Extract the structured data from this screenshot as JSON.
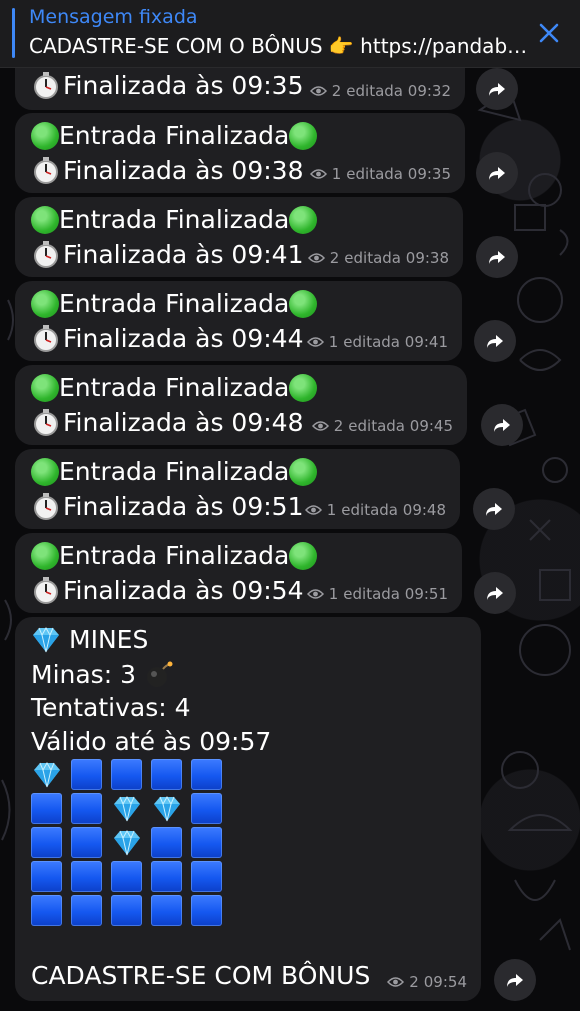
{
  "pinned": {
    "title": "Mensagem fixada",
    "text": "CADASTRE-SE COM O BÔNUS 👉 https://pandabet...",
    "close_icon": "close-icon",
    "accent_color": "#3e88f7"
  },
  "messages": [
    {
      "line1": "",
      "line2": "Finalizada às 09:35",
      "views": "2",
      "edited": "editada 09:32",
      "partial": true
    },
    {
      "line1": "Entrada Finalizada",
      "line2": "Finalizada às 09:38",
      "views": "1",
      "edited": "editada 09:35"
    },
    {
      "line1": "Entrada Finalizada",
      "line2": "Finalizada às 09:41",
      "views": "2",
      "edited": "editada 09:38"
    },
    {
      "line1": "Entrada Finalizada",
      "line2": "Finalizada às 09:44",
      "views": "1",
      "edited": "editada 09:41"
    },
    {
      "line1": "Entrada Finalizada",
      "line2": "Finalizada às 09:48",
      "views": "2",
      "edited": "editada 09:45"
    },
    {
      "line1": "Entrada Finalizada",
      "line2": "Finalizada às 09:51",
      "views": "1",
      "edited": "editada 09:48"
    },
    {
      "line1": "Entrada Finalizada",
      "line2": "Finalizada às 09:54",
      "views": "1",
      "edited": "editada 09:51"
    }
  ],
  "mines_message": {
    "title": "MINES",
    "minas": "Minas: 3",
    "tentativas": "Tentativas: 4",
    "valido": "Válido até às 09:57",
    "grid": [
      [
        "diamond",
        "square",
        "square",
        "square",
        "square"
      ],
      [
        "square",
        "square",
        "diamond",
        "diamond",
        "square"
      ],
      [
        "square",
        "square",
        "diamond",
        "square",
        "square"
      ],
      [
        "square",
        "square",
        "square",
        "square",
        "square"
      ],
      [
        "square",
        "square",
        "square",
        "square",
        "square"
      ]
    ],
    "footer": "CADASTRE-SE COM BÔNUS",
    "views": "2",
    "time": "09:54"
  }
}
